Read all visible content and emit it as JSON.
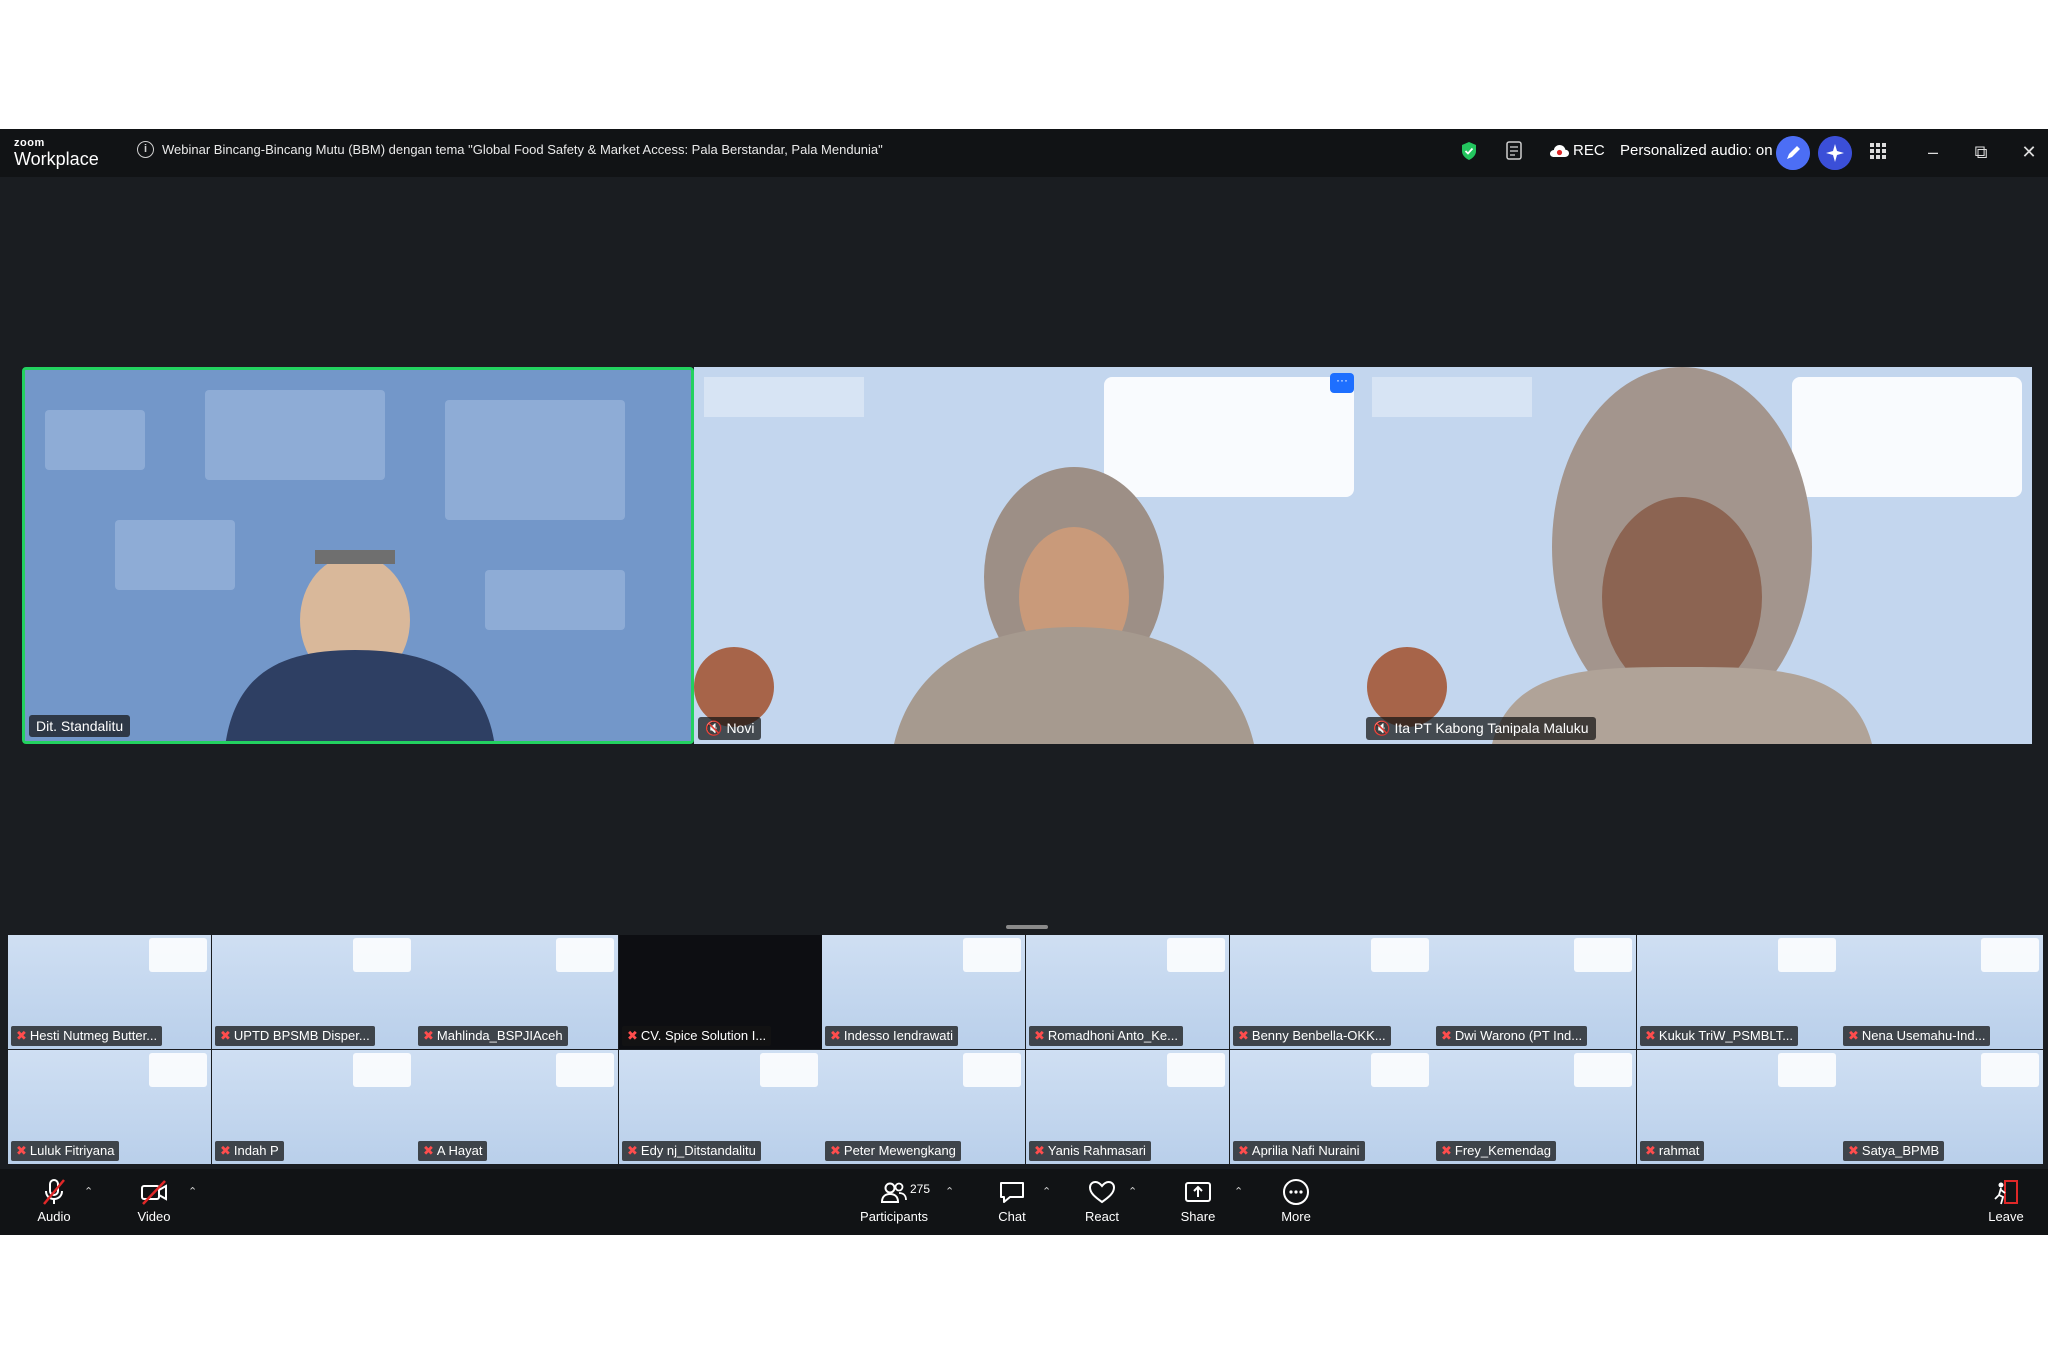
{
  "titlebar": {
    "app_small": "zoom",
    "app_big": "Workplace",
    "meeting_title": "Webinar Bincang-Bincang Mutu (BBM) dengan tema \"Global Food Safety & Market Access: Pala Berstandar, Pala Mendunia\"",
    "rec_label": "REC",
    "audio_label": "Personalized audio: on"
  },
  "main_tiles": [
    {
      "name": "Dit. Standalitu"
    },
    {
      "name": "Novi"
    },
    {
      "name": "Ita PT Kabong Tanipala Maluku"
    }
  ],
  "gallery": {
    "row1": [
      "Hesti Nutmeg Butter...",
      "UPTD BPSMB Disper...",
      "Mahlinda_BSPJIAceh",
      "CV. Spice Solution I...",
      "Indesso Iendrawati",
      "Romadhoni Anto_Ke...",
      "Benny Benbella-OKK...",
      "Dwi Warono (PT Ind...",
      "Kukuk TriW_PSMBLT...",
      "Nena Usemahu-Ind..."
    ],
    "row2": [
      "Luluk Fitriyana",
      "Indah P",
      "A Hayat",
      "Edy nj_Ditstandalitu",
      "Peter Mewengkang",
      "Yanis Rahmasari",
      "Aprilia Nafi Nuraini",
      "Frey_Kemendag",
      "rahmat",
      "Satya_BPMB"
    ]
  },
  "toolbar": {
    "audio": "Audio",
    "video": "Video",
    "participants": "Participants",
    "participant_count": "275",
    "chat": "Chat",
    "react": "React",
    "share": "Share",
    "more": "More",
    "leave": "Leave"
  },
  "colors": {
    "active_speaker_border": "#23d160",
    "leave_red": "#e02828"
  }
}
